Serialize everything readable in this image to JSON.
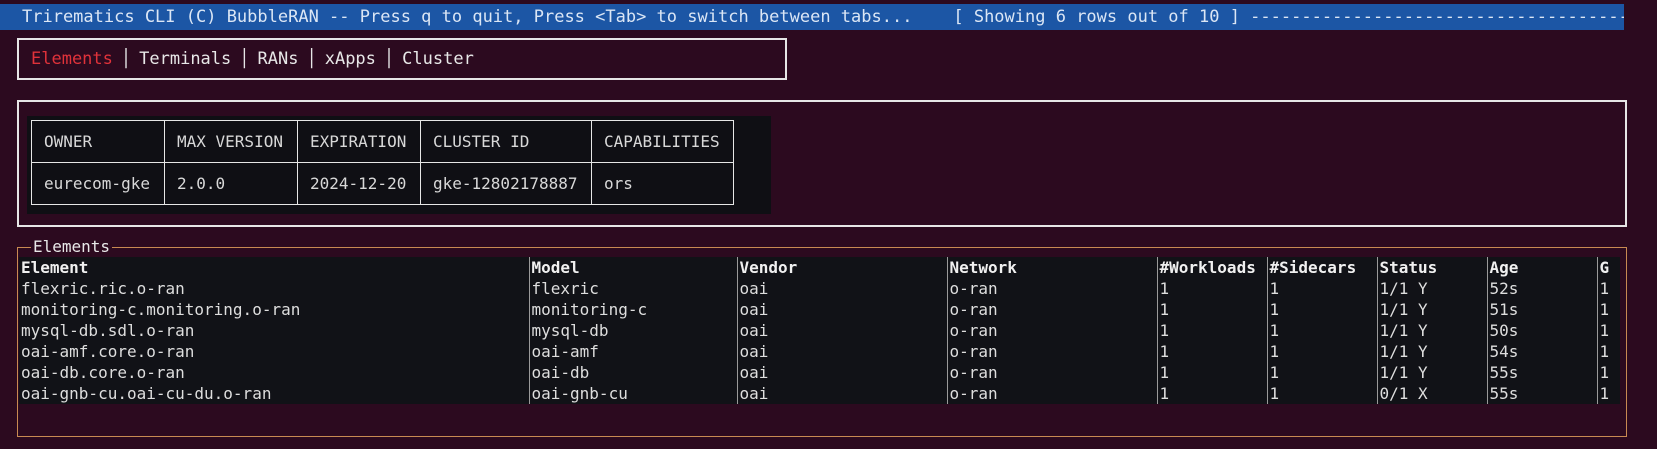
{
  "status_bar": {
    "text": "Trirematics CLI (C) BubbleRAN -- Press q to quit, Press <Tab> to switch between tabs...    [ Showing 6 rows out of 10 ] ----------------------------------------------------------"
  },
  "tabs": [
    {
      "label": "Elements",
      "active": true
    },
    {
      "label": "Terminals",
      "active": false
    },
    {
      "label": "RANs",
      "active": false
    },
    {
      "label": "xApps",
      "active": false
    },
    {
      "label": "Cluster",
      "active": false
    }
  ],
  "license": {
    "headers": [
      "OWNER",
      "MAX VERSION",
      "EXPIRATION",
      "CLUSTER ID",
      "CAPABILITIES"
    ],
    "row": [
      "eurecom-gke",
      "2.0.0",
      "2024-12-20",
      "gke-12802178887",
      "ors"
    ]
  },
  "elements": {
    "title": "Elements",
    "headers": [
      "Element",
      "Model",
      "Vendor",
      "Network",
      "#Workloads",
      "#Sidecars",
      "Status",
      "Age",
      "G"
    ],
    "rows": [
      [
        "flexric.ric.o-ran",
        "flexric",
        "oai",
        "o-ran",
        "1",
        "1",
        "1/1 Y",
        "52s",
        "1"
      ],
      [
        "monitoring-c.monitoring.o-ran",
        "monitoring-c",
        "oai",
        "o-ran",
        "1",
        "1",
        "1/1 Y",
        "51s",
        "1"
      ],
      [
        "mysql-db.sdl.o-ran",
        "mysql-db",
        "oai",
        "o-ran",
        "1",
        "1",
        "1/1 Y",
        "50s",
        "1"
      ],
      [
        "oai-amf.core.o-ran",
        "oai-amf",
        "oai",
        "o-ran",
        "1",
        "1",
        "1/1 Y",
        "54s",
        "1"
      ],
      [
        "oai-db.core.o-ran",
        "oai-db",
        "oai",
        "o-ran",
        "1",
        "1",
        "1/1 Y",
        "55s",
        "1"
      ],
      [
        "oai-gnb-cu.oai-cu-du.o-ran",
        "oai-gnb-cu",
        "oai",
        "o-ran",
        "1",
        "1",
        "0/1 X",
        "55s",
        "1"
      ]
    ]
  },
  "colors": {
    "background": "#2c0a1f",
    "status_bar": "#1c56a5",
    "active_tab": "#e0323a",
    "elements_border": "#c88a52"
  }
}
